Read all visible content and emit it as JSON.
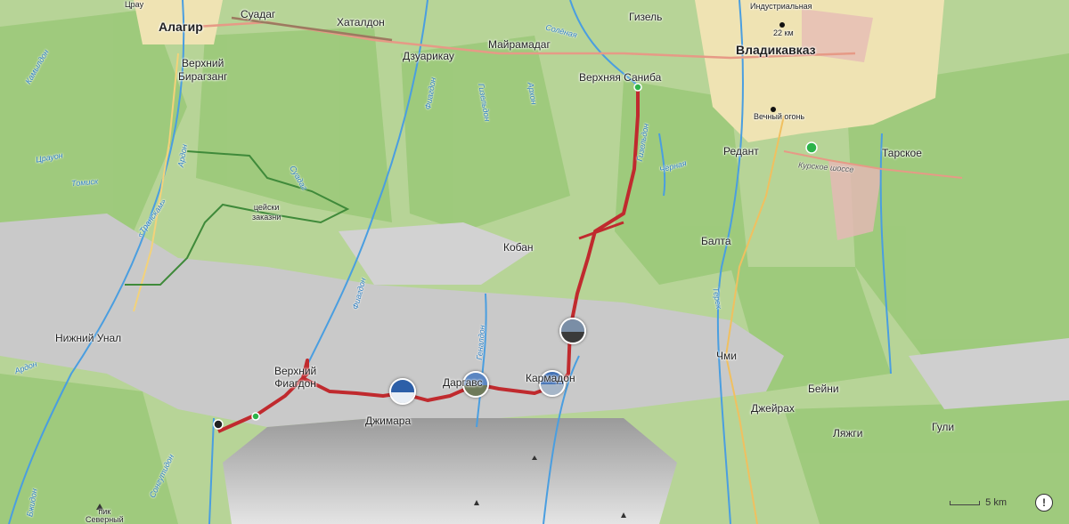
{
  "map": {
    "places": [
      {
        "id": "alagir",
        "text": "Алагир",
        "cls": "city"
      },
      {
        "id": "vladikavkaz",
        "text": "Владикавказ",
        "cls": "city"
      },
      {
        "id": "suadag",
        "text": "Суадаг"
      },
      {
        "id": "khataldon",
        "text": "Хаталдон"
      },
      {
        "id": "dzuarikau",
        "text": "Дзуарикау"
      },
      {
        "id": "mayramadag",
        "text": "Майрамадаг"
      },
      {
        "id": "gizel",
        "text": "Гизель"
      },
      {
        "id": "verkhny-biragzang",
        "text": "Верхний\nБирагзанг"
      },
      {
        "id": "verkhnyaya-saniba",
        "text": "Верхняя Саниба"
      },
      {
        "id": "redant",
        "text": "Редант"
      },
      {
        "id": "tarskoe",
        "text": "Тарское"
      },
      {
        "id": "koban",
        "text": "Кобан"
      },
      {
        "id": "balta",
        "text": "Балта"
      },
      {
        "id": "chmi",
        "text": "Чми"
      },
      {
        "id": "beyni",
        "text": "Бейни"
      },
      {
        "id": "dzheyrakh",
        "text": "Джейрах"
      },
      {
        "id": "lyazhgi",
        "text": "Ляжги"
      },
      {
        "id": "guli",
        "text": "Гули"
      },
      {
        "id": "nizhny-unal",
        "text": "Нижний Унал"
      },
      {
        "id": "verkhny-fiagdon",
        "text": "Верхний\nФиагдон"
      },
      {
        "id": "dzhimara",
        "text": "Джимара"
      },
      {
        "id": "dargavs",
        "text": "Даргавс"
      },
      {
        "id": "karmadon",
        "text": "Кармадон"
      },
      {
        "id": "zakaznik",
        "text": "цейски\nзаказни",
        "cls": "small"
      },
      {
        "id": "industrialnaya",
        "text": "Индустриальная",
        "cls": "small"
      },
      {
        "id": "km22",
        "text": "22 км",
        "cls": "small"
      },
      {
        "id": "vechny-ogon",
        "text": "Вечный огонь",
        "cls": "small"
      },
      {
        "id": "peak",
        "text": "пик\nСеверный",
        "cls": "small"
      },
      {
        "id": "tsrau",
        "text": "Црау",
        "cls": "small"
      }
    ],
    "rivers": [
      {
        "id": "ardon",
        "text": "Ардон"
      },
      {
        "id": "ardon2",
        "text": "Ардон"
      },
      {
        "id": "fiagdon",
        "text": "Фиагдон"
      },
      {
        "id": "fiagdon2",
        "text": "Фиагдон"
      },
      {
        "id": "suadag-river",
        "text": "Суадаг"
      },
      {
        "id": "gizeldon",
        "text": "Гизельдон"
      },
      {
        "id": "terek",
        "text": "Терек"
      },
      {
        "id": "chernaya",
        "text": "Чёрная"
      },
      {
        "id": "tomisk",
        "text": "Томиск"
      },
      {
        "id": "tsrauldon",
        "text": "Црауон"
      },
      {
        "id": "kamyldon",
        "text": "Камылдон"
      },
      {
        "id": "genaldon",
        "text": "Геналдон"
      },
      {
        "id": "solenaya",
        "text": "Солёная"
      },
      {
        "id": "arkhon",
        "text": "Архон"
      },
      {
        "id": "songuti",
        "text": "Сонгутидон"
      },
      {
        "id": "bzhsh",
        "text": "Бжидон"
      },
      {
        "id": "gizeldon2",
        "text": "Гизельдон"
      },
      {
        "id": "transkam",
        "text": "«Транскам»"
      }
    ],
    "roads": {
      "kurtat_shosse": "Курское шоссе"
    },
    "photos": [
      {
        "id": "photo-dzhimara",
        "sky": "#2d5fa8",
        "ground": "#e8eef5"
      },
      {
        "id": "photo-dargavs",
        "sky": "#5b86c2",
        "ground": "#6e7a5a"
      },
      {
        "id": "photo-karmadon",
        "sky": "#3f6fb5",
        "ground": "#a6b6c8"
      },
      {
        "id": "photo-monastery",
        "sky": "#7a8ea6",
        "ground": "#3a3a3a"
      }
    ],
    "scale_label": "5 km",
    "info_label": "!",
    "colors": {
      "route": "#c02a2e",
      "forest": "#9ccb7a",
      "meadow": "#b9d59a",
      "rock": "#c8c8c8",
      "river": "#4a9ee0",
      "urban": "#f2e6b0",
      "road_major": "#e69a86",
      "trail_green": "#3f8a3a"
    }
  }
}
